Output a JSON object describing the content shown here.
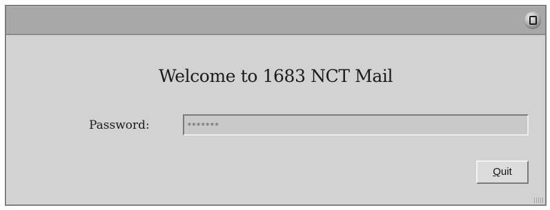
{
  "window": {
    "close_icon": "close-icon"
  },
  "welcome_text": "Welcome to 1683 NCT Mail",
  "password": {
    "label": "Password:",
    "masked_value": "*******"
  },
  "buttons": {
    "quit_mnemonic": "Q",
    "quit_rest": "uit"
  },
  "colors": {
    "window_bg": "#d2d2d2",
    "titlebar_bg": "#a8a8a8",
    "field_bg": "#c9c9c9"
  }
}
